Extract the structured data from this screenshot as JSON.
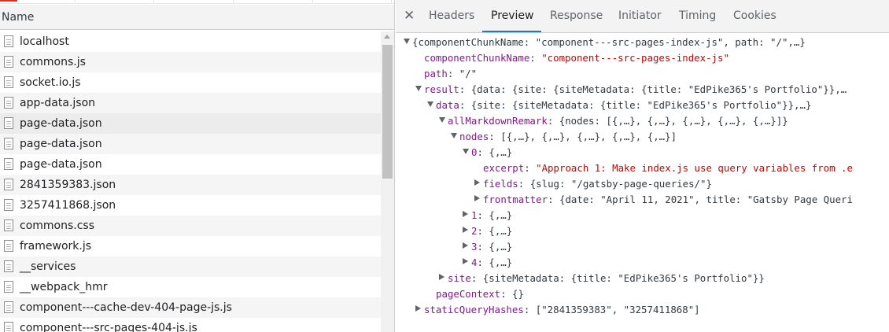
{
  "network": {
    "column_header": "Name",
    "rows": [
      {
        "name": "localhost"
      },
      {
        "name": "commons.js"
      },
      {
        "name": "socket.io.js"
      },
      {
        "name": "app-data.json"
      },
      {
        "name": "page-data.json",
        "selected": true
      },
      {
        "name": "page-data.json"
      },
      {
        "name": "page-data.json"
      },
      {
        "name": "2841359383.json"
      },
      {
        "name": "3257411868.json"
      },
      {
        "name": "commons.css"
      },
      {
        "name": "framework.js"
      },
      {
        "name": "__services"
      },
      {
        "name": "__webpack_hmr"
      },
      {
        "name": "component---cache-dev-404-page-js.js"
      },
      {
        "name": "component---src-pages-404-js.js"
      }
    ]
  },
  "panel": {
    "close_glyph": "✕",
    "tabs": [
      {
        "label": "Headers"
      },
      {
        "label": "Preview",
        "active": true
      },
      {
        "label": "Response"
      },
      {
        "label": "Initiator"
      },
      {
        "label": "Timing"
      },
      {
        "label": "Cookies"
      }
    ]
  },
  "tree": [
    {
      "indent": 0,
      "toggle": "down",
      "key": "",
      "value": "{componentChunkName: \"component---src-pages-index-js\", path: \"/\",…}"
    },
    {
      "indent": 1,
      "toggle": "",
      "key": "componentChunkName",
      "value": "\"component---src-pages-index-js\"",
      "string": true
    },
    {
      "indent": 1,
      "toggle": "",
      "key": "path",
      "value": "\"/\"",
      "string": false
    },
    {
      "indent": 1,
      "toggle": "down",
      "key": "result",
      "value": "{data: {site: {siteMetadata: {title: \"EdPike365's Portfolio\"}},…"
    },
    {
      "indent": 2,
      "toggle": "down",
      "key": "data",
      "value": "{site: {siteMetadata: {title: \"EdPike365's Portfolio\"}},…}"
    },
    {
      "indent": 3,
      "toggle": "down",
      "key": "allMarkdownRemark",
      "value": "{nodes: [{,…}, {,…}, {,…}, {,…}, {,…}]}"
    },
    {
      "indent": 4,
      "toggle": "down",
      "key": "nodes",
      "value": "[{,…}, {,…}, {,…}, {,…}, {,…}]"
    },
    {
      "indent": 5,
      "toggle": "down",
      "key": "0",
      "value": "{,…}"
    },
    {
      "indent": 6,
      "toggle": "",
      "key": "excerpt",
      "value": "\"Approach 1: Make index.js use query variables from .e",
      "string": true
    },
    {
      "indent": 6,
      "toggle": "right",
      "key": "fields",
      "value": "{slug: \"/gatsby-page-queries/\"}"
    },
    {
      "indent": 6,
      "toggle": "right",
      "key": "frontmatter",
      "value": "{date: \"April 11, 2021\", title: \"Gatsby Page Queri"
    },
    {
      "indent": 5,
      "toggle": "right",
      "key": "1",
      "value": "{,…}"
    },
    {
      "indent": 5,
      "toggle": "right",
      "key": "2",
      "value": "{,…}"
    },
    {
      "indent": 5,
      "toggle": "right",
      "key": "3",
      "value": "{,…}"
    },
    {
      "indent": 5,
      "toggle": "right",
      "key": "4",
      "value": "{,…}"
    },
    {
      "indent": 3,
      "toggle": "right",
      "key": "site",
      "value": "{siteMetadata: {title: \"EdPike365's Portfolio\"}}"
    },
    {
      "indent": 2,
      "toggle": "",
      "key": "pageContext",
      "value": "{}"
    },
    {
      "indent": 1,
      "toggle": "right",
      "key": "staticQueryHashes",
      "value": "[\"2841359383\", \"3257411868\"]"
    }
  ]
}
